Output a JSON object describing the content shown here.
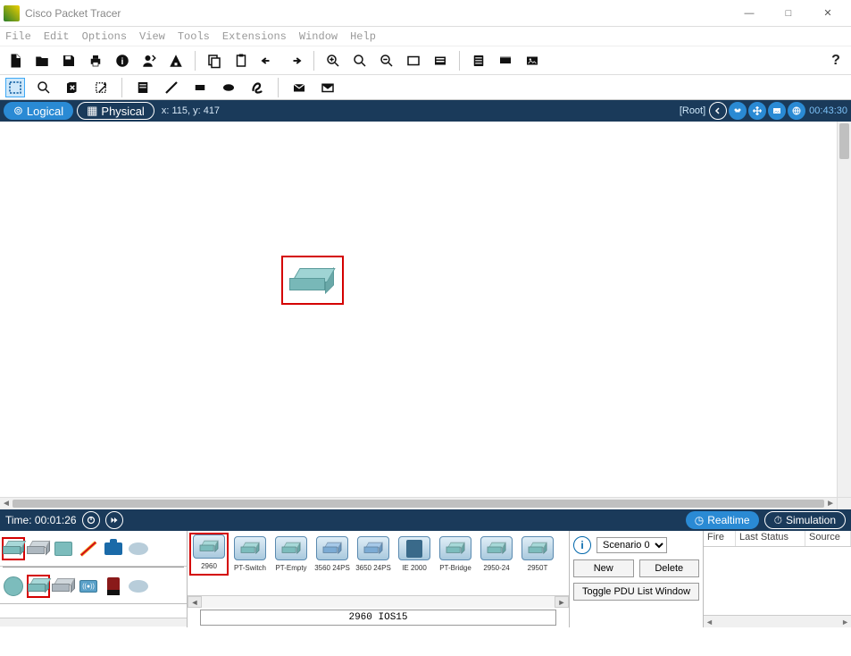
{
  "window": {
    "title": "Cisco Packet Tracer",
    "minimize": "—",
    "maximize": "□",
    "close": "✕"
  },
  "menus": [
    "File",
    "Edit",
    "Options",
    "View",
    "Tools",
    "Extensions",
    "Window",
    "Help"
  ],
  "nav": {
    "logical": "Logical",
    "physical": "Physical",
    "coords": "x: 115, y: 417",
    "root": "[Root]",
    "clock": "00:43:30"
  },
  "timebar": {
    "label": "Time: 00:01:26",
    "realtime": "Realtime",
    "simulation": "Simulation"
  },
  "devices": {
    "items": [
      {
        "label": "2960"
      },
      {
        "label": "PT-Switch"
      },
      {
        "label": "PT-Empty"
      },
      {
        "label": "3560 24PS"
      },
      {
        "label": "3650 24PS"
      },
      {
        "label": "IE 2000"
      },
      {
        "label": "PT-Bridge"
      },
      {
        "label": "2950-24"
      },
      {
        "label": "2950T"
      }
    ],
    "status": "2960 IOS15"
  },
  "scenario": {
    "selected": "Scenario 0",
    "new": "New",
    "delete": "Delete",
    "toggle": "Toggle PDU List Window"
  },
  "pdu": {
    "cols": [
      "Fire",
      "Last Status",
      "Source"
    ]
  }
}
